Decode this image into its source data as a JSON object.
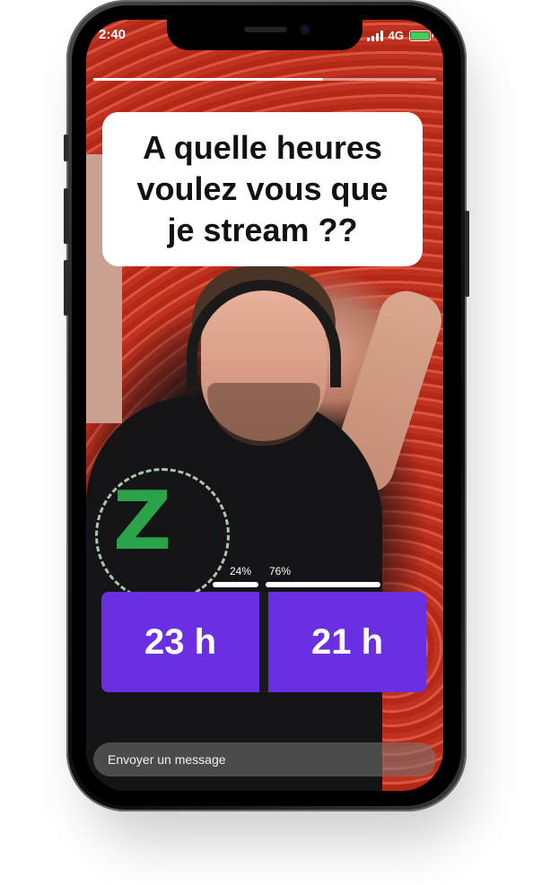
{
  "status_bar": {
    "time": "2:40",
    "network": "4G",
    "battery_color": "#3ad15c"
  },
  "story": {
    "progress": 0.67
  },
  "question": {
    "text": "A quelle heures voulez vous que je stream ??"
  },
  "poll": {
    "accent_color": "#6a2ee3",
    "options": [
      {
        "label": "23 h",
        "percent_label": "24%",
        "percent": 24
      },
      {
        "label": "21 h",
        "percent_label": "76%",
        "percent": 76
      }
    ]
  },
  "message_bar": {
    "placeholder": "Envoyer un message"
  },
  "icons": [
    "signal-icon",
    "battery-icon",
    "camera-icon"
  ]
}
